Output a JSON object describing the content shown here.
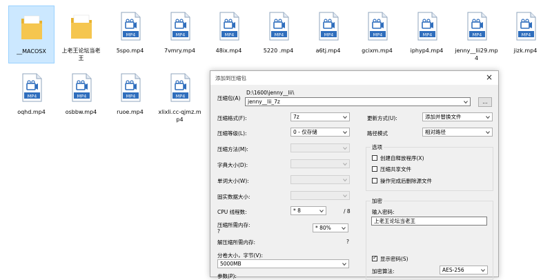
{
  "explorer": {
    "files": [
      {
        "name": "__MACOSX",
        "type": "folder",
        "selected": true
      },
      {
        "name": "上老王论坛当老王",
        "type": "folder",
        "selected": false
      },
      {
        "name": "5spo.mp4",
        "type": "mp4"
      },
      {
        "name": "7vmry.mp4",
        "type": "mp4"
      },
      {
        "name": "48ix.mp4",
        "type": "mp4"
      },
      {
        "name": "5220 .mp4",
        "type": "mp4"
      },
      {
        "name": "a6tj.mp4",
        "type": "mp4"
      },
      {
        "name": "gcixm.mp4",
        "type": "mp4"
      },
      {
        "name": "iphyp4.mp4",
        "type": "mp4"
      },
      {
        "name": "jenny__lii29.mp4",
        "type": "mp4"
      },
      {
        "name": "jizk.mp4",
        "type": "mp4"
      },
      {
        "name": "oqhd.mp4",
        "type": "mp4"
      },
      {
        "name": "osbbw.mp4",
        "type": "mp4"
      },
      {
        "name": "ruoe.mp4",
        "type": "mp4"
      },
      {
        "name": "xlixli.cc-qjmz.mp4",
        "type": "mp4"
      }
    ],
    "icon_text": "MP4",
    "colors": {
      "folder": "#f5c64f",
      "folder_dark": "#e8b22d",
      "video": "#2f6ebd",
      "select_bg": "#cce8ff"
    }
  },
  "dialog": {
    "title": "添加到压缩包",
    "close_glyph": "×",
    "archive": {
      "label": "压缩包(A)",
      "path": "D:\\1600\\jenny__lii\\",
      "filename": "jenny__lii_7z",
      "browse": "..."
    },
    "left": {
      "format": {
        "label": "压缩格式(F):",
        "value": "7z"
      },
      "level": {
        "label": "压缩等级(L):",
        "value": "0 - 仅存储"
      },
      "method": {
        "label": "压缩方法(M):",
        "value": ""
      },
      "dict": {
        "label": "字典大小(D):",
        "value": ""
      },
      "word": {
        "label": "单词大小(W):",
        "value": ""
      },
      "solid": {
        "label": "固实数据大小:",
        "value": ""
      },
      "cpu": {
        "label": "CPU 线程数:",
        "value": "* 8",
        "total": "/ 8"
      },
      "mem_compress": {
        "label": "压缩所需内存:",
        "label2": "?",
        "value": "* 80%"
      },
      "mem_decompress": {
        "label": "解压缩所需内存:",
        "value": "?"
      },
      "split": {
        "label": "分卷大小，字节(V):",
        "value": "5000MB"
      },
      "params": {
        "label": "参数(P):"
      }
    },
    "right": {
      "update": {
        "label": "更新方式(U):",
        "value": "添加并替换文件"
      },
      "pathmode": {
        "label": "路径模式",
        "value": "相对路径"
      },
      "options": {
        "title": "选项",
        "items": [
          {
            "label": "创建自释放程序(X)",
            "checked": false
          },
          {
            "label": "压缩共享文件",
            "checked": false
          },
          {
            "label": "操作完成后删除源文件",
            "checked": false
          }
        ]
      },
      "encrypt": {
        "title": "加密",
        "pw_label": "输入密码:",
        "pw_value": "上老王论坛当老王",
        "show_pw": {
          "label": "显示密码(S)",
          "checked": true
        },
        "algo_label": "加密算法:",
        "algo_value": "AES-256"
      }
    }
  }
}
